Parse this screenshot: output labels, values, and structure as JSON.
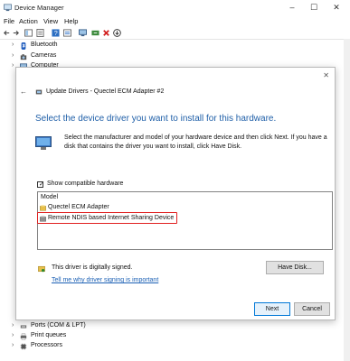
{
  "device_manager": {
    "title": "Device Manager",
    "window_controls": {
      "minimize": "–",
      "maximize": "☐",
      "close": "✕"
    },
    "menu": [
      "File",
      "Action",
      "View",
      "Help"
    ],
    "tree_top": [
      {
        "label": "Bluetooth",
        "icon": "bluetooth-icon"
      },
      {
        "label": "Cameras",
        "icon": "camera-icon"
      },
      {
        "label": "Computer",
        "icon": "computer-icon"
      }
    ],
    "tree_bottom": [
      {
        "label": "Ports (COM & LPT)",
        "icon": "port-icon"
      },
      {
        "label": "Print queues",
        "icon": "printer-icon"
      },
      {
        "label": "Processors",
        "icon": "processor-icon"
      }
    ],
    "tree_arrow": "›"
  },
  "wizard": {
    "close": "✕",
    "back": "←",
    "title": "Update Drivers - Quectel ECM Adapter #2",
    "heading": "Select the device driver you want to install for this hardware.",
    "description": "Select the manufacturer and model of your hardware device and then click Next. If you have a disk that contains the driver you want to install, click Have Disk.",
    "show_compatible": {
      "label": "Show compatible hardware",
      "checked": true,
      "mark": "✓"
    },
    "model_list": {
      "header": "Model",
      "items": [
        {
          "label": "Quectel ECM Adapter",
          "selected": false
        },
        {
          "label": "Remote NDIS based Internet Sharing Device",
          "selected": true
        }
      ]
    },
    "signed_text": "This driver is digitally signed.",
    "signing_link": "Tell me why driver signing is important",
    "buttons": {
      "have_disk": "Have Disk...",
      "next": "Next",
      "cancel": "Cancel"
    },
    "colors": {
      "heading": "#1f5fa8",
      "highlight": "#e02020",
      "link": "#1a5fb4"
    }
  }
}
